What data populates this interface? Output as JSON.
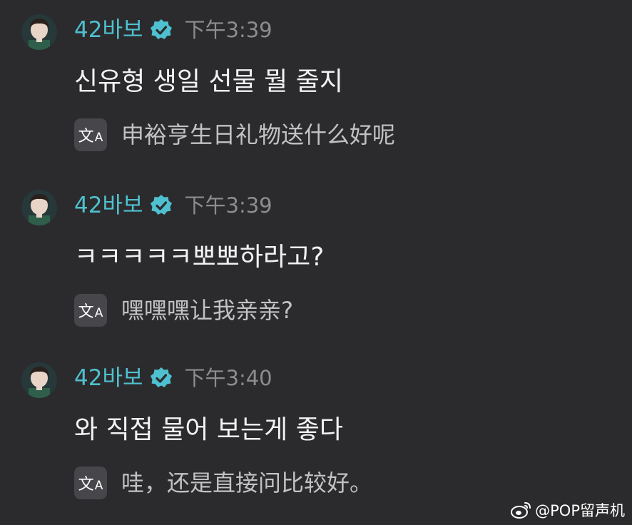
{
  "messages": [
    {
      "username": "42바보",
      "timestamp": "下午3:39",
      "text": "신유형 생일 선물 뭘 줄지",
      "translation": "申裕亨生日礼物送什么好呢"
    },
    {
      "username": "42바보",
      "timestamp": "下午3:39",
      "text": "ㅋㅋㅋㅋㅋ뽀뽀하라고?",
      "translation": "嘿嘿嘿让我亲亲?"
    },
    {
      "username": "42바보",
      "timestamp": "下午3:40",
      "text": "와 직접 물어 보는게 좋다",
      "translation": "哇，还是直接问比较好。"
    }
  ],
  "icons": {
    "verified": "verified-badge-icon",
    "translate": "translate-icon",
    "weibo": "weibo-icon"
  },
  "colors": {
    "background": "#2b2b2d",
    "username": "#4fc0cf",
    "verified_badge": "#4fc0cf",
    "timestamp": "#8d8d90",
    "message_text": "#f2f2f2",
    "translation_text": "#c2c2c5"
  },
  "watermark": {
    "text": "@POP留声机"
  }
}
